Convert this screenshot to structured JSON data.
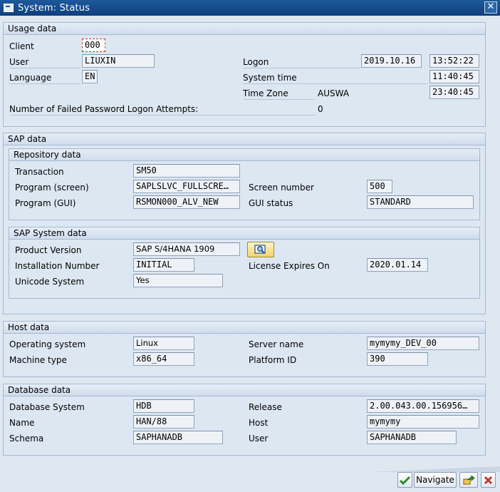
{
  "window": {
    "title": "System: Status"
  },
  "usage": {
    "header": "Usage data",
    "client_label": "Client",
    "client_value": "000",
    "user_label": "User",
    "user_value": "LIUXIN",
    "language_label": "Language",
    "language_value": "EN",
    "logon_label": "Logon",
    "logon_date": "2019.10.16",
    "logon_time": "13:52:22",
    "system_time_label": "System time",
    "system_time_value": "11:40:45",
    "timezone_label": "Time Zone",
    "timezone_name": "AUSWA",
    "timezone_time": "23:40:45",
    "failed_label": "Number of Failed Password Logon Attempts:",
    "failed_value": "0"
  },
  "sap": {
    "header": "SAP data",
    "repo": {
      "header": "Repository data",
      "transaction_label": "Transaction",
      "transaction_value": "SM50",
      "program_screen_label": "Program (screen)",
      "program_screen_value": "SAPLSLVC_FULLSCRE…",
      "screen_number_label": "Screen number",
      "screen_number_value": "500",
      "program_gui_label": "Program (GUI)",
      "program_gui_value": "RSMON000_ALV_NEW",
      "gui_status_label": "GUI status",
      "gui_status_value": "STANDARD"
    },
    "system": {
      "header": "SAP System data",
      "product_label": "Product Version",
      "product_value": "SAP S/4HANA 1909",
      "install_label": "Installation Number",
      "install_value": "INITIAL",
      "license_label": "License Expires On",
      "license_value": "2020.01.14",
      "unicode_label": "Unicode System",
      "unicode_value": "Yes"
    }
  },
  "host": {
    "header": "Host data",
    "os_label": "Operating system",
    "os_value": "Linux",
    "server_label": "Server name",
    "server_value": "mymymy_DEV_00",
    "machine_label": "Machine type",
    "machine_value": "x86_64",
    "platform_label": "Platform ID",
    "platform_value": "390"
  },
  "db": {
    "header": "Database data",
    "system_label": "Database System",
    "system_value": "HDB",
    "release_label": "Release",
    "release_value": "2.00.043.00.156956…",
    "name_label": "Name",
    "name_value": "HAN/88",
    "host_label": "Host",
    "host_value": "mymymy",
    "schema_label": "Schema",
    "schema_value": "SAPHANADB",
    "user_label": "User",
    "user_value": "SAPHANADB"
  },
  "toolbar": {
    "navigate_label": "Navigate"
  },
  "colors": {
    "title_bar": "#1d5a9c",
    "ok_green": "#2e8b2e",
    "cancel_red": "#c0392b"
  }
}
